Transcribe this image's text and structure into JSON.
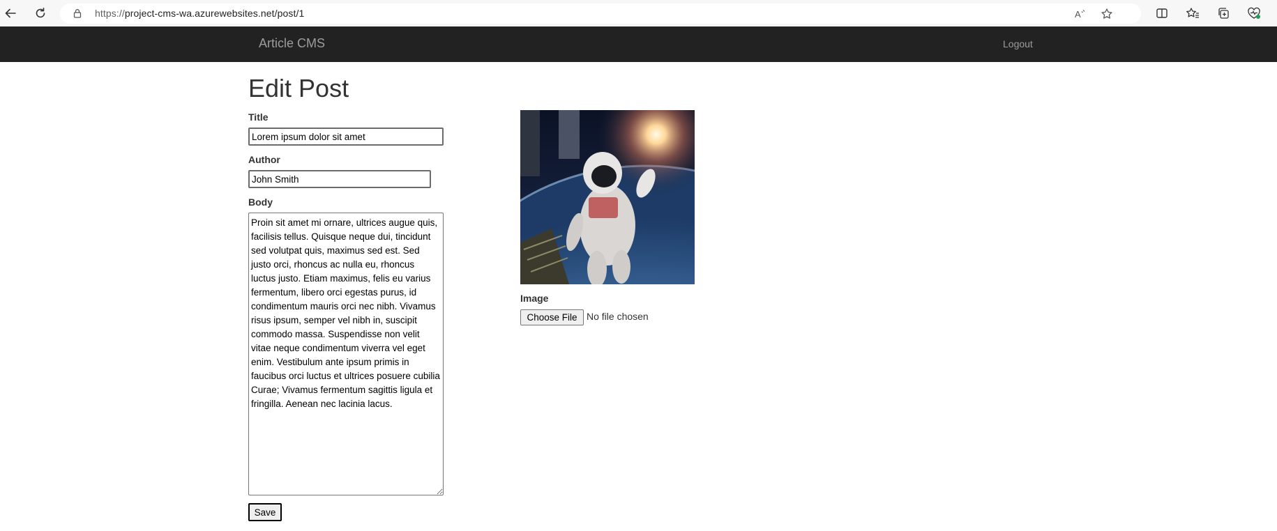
{
  "browser": {
    "url_scheme": "https://",
    "url_rest": "project-cms-wa.azurewebsites.net/post/1"
  },
  "navbar": {
    "brand": "Article CMS",
    "logout_label": "Logout"
  },
  "page": {
    "title": "Edit Post"
  },
  "form": {
    "title_label": "Title",
    "title_value": "Lorem ipsum dolor sit amet",
    "author_label": "Author",
    "author_value": "John Smith",
    "body_label": "Body",
    "body_value": "Proin sit amet mi ornare, ultrices augue quis, facilisis tellus. Quisque neque dui, tincidunt sed volutpat quis, maximus sed est. Sed justo orci, rhoncus ac nulla eu, rhoncus luctus justo. Etiam maximus, felis eu varius fermentum, libero orci egestas purus, id condimentum mauris orci nec nibh. Vivamus risus ipsum, semper vel nibh in, suscipit commodo massa. Suspendisse non velit vitae neque condimentum viverra vel eget enim. Vestibulum ante ipsum primis in faucibus orci luctus et ultrices posuere cubilia Curae; Vivamus fermentum sagittis ligula et fringilla. Aenean nec lacinia lacus.",
    "save_label": "Save"
  },
  "image_section": {
    "image_label": "Image",
    "choose_file_label": "Choose File",
    "file_status": "No file chosen"
  },
  "icons": {
    "back": "back-arrow-icon",
    "refresh": "refresh-icon",
    "lock": "lock-icon",
    "read_aloud": "read-aloud-icon",
    "favorite": "star-icon",
    "split_screen": "split-screen-icon",
    "favorites": "favorites-icon",
    "collections": "collections-icon",
    "health": "browser-essentials-icon"
  },
  "colors": {
    "navbar_bg": "#222222",
    "navbar_text": "#9d9d9d"
  }
}
